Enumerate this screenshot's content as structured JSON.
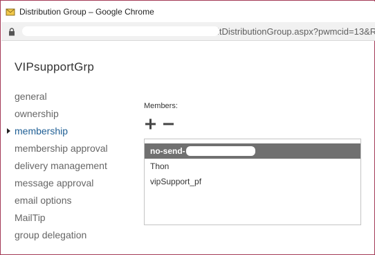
{
  "window": {
    "title": "Distribution Group – Google Chrome",
    "url_visible": "itDistributionGroup.aspx?pwmcid=13&R"
  },
  "page": {
    "title": "VIPsupportGrp"
  },
  "nav": {
    "items": [
      {
        "label": "general",
        "active": false
      },
      {
        "label": "ownership",
        "active": false
      },
      {
        "label": "membership",
        "active": true
      },
      {
        "label": "membership approval",
        "active": false
      },
      {
        "label": "delivery management",
        "active": false
      },
      {
        "label": "message approval",
        "active": false
      },
      {
        "label": "email options",
        "active": false
      },
      {
        "label": "MailTip",
        "active": false
      },
      {
        "label": "group delegation",
        "active": false
      }
    ]
  },
  "members": {
    "label": "Members:",
    "items": [
      {
        "name": "no-send-",
        "selected": true
      },
      {
        "name": "Thon",
        "selected": false
      },
      {
        "name": "vipSupport_pf",
        "selected": false
      }
    ]
  },
  "colors": {
    "accent": "#1f5f95",
    "selected_row": "#707070",
    "window_border": "#a33a56"
  },
  "icons": {
    "add": "plus-icon",
    "remove": "minus-icon",
    "lock": "lock-icon",
    "app": "distribution-group-icon"
  }
}
